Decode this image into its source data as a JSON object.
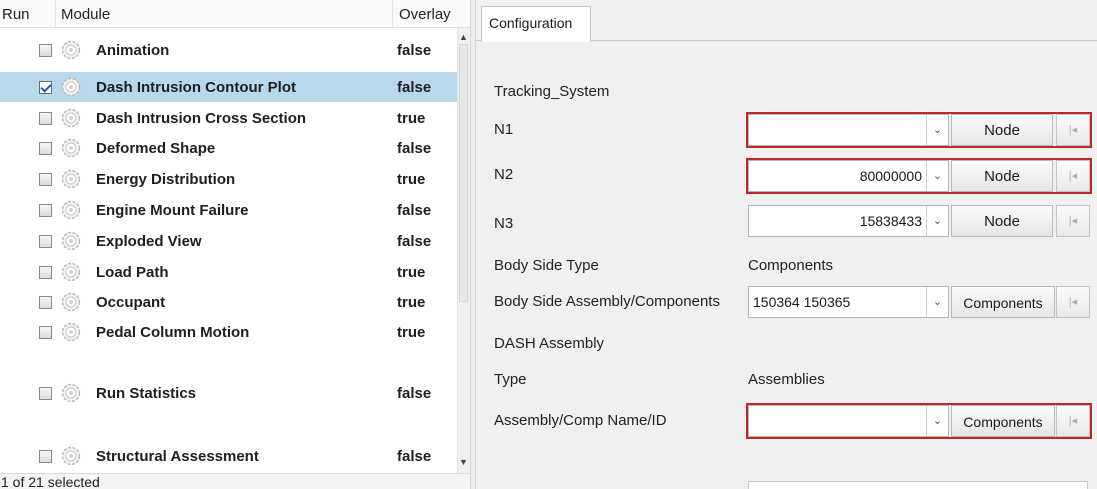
{
  "left_panel": {
    "columns": {
      "run": "Run",
      "module": "Module",
      "overlay": "Overlay"
    },
    "rows": [
      {
        "name": "Animation",
        "overlay": "false",
        "checked": false,
        "selected": false
      },
      {
        "name": "Dash Intrusion Contour Plot",
        "overlay": "false",
        "checked": true,
        "selected": true
      },
      {
        "name": "Dash Intrusion Cross Section",
        "overlay": "true",
        "checked": false,
        "selected": false
      },
      {
        "name": "Deformed Shape",
        "overlay": "false",
        "checked": false,
        "selected": false
      },
      {
        "name": "Energy Distribution",
        "overlay": "true",
        "checked": false,
        "selected": false
      },
      {
        "name": "Engine Mount Failure",
        "overlay": "false",
        "checked": false,
        "selected": false
      },
      {
        "name": "Exploded View",
        "overlay": "false",
        "checked": false,
        "selected": false
      },
      {
        "name": "Load Path",
        "overlay": "true",
        "checked": false,
        "selected": false
      },
      {
        "name": "Occupant",
        "overlay": "true",
        "checked": false,
        "selected": false
      },
      {
        "name": "Pedal Column Motion",
        "overlay": "true",
        "checked": false,
        "selected": false
      },
      {
        "name": "Run Statistics",
        "overlay": "false",
        "checked": false,
        "selected": false
      },
      {
        "name": "Structural Assessment",
        "overlay": "false",
        "checked": false,
        "selected": false
      }
    ],
    "status": "1 of 21 selected"
  },
  "right_panel": {
    "tab": "Configuration",
    "section_tracking": "Tracking_System",
    "n1": {
      "label": "N1",
      "value": "",
      "button": "Node"
    },
    "n2": {
      "label": "N2",
      "value": "80000000",
      "button": "Node"
    },
    "n3": {
      "label": "N3",
      "value": "15838433",
      "button": "Node"
    },
    "body_side_type": {
      "label": "Body Side Type",
      "value": "Components"
    },
    "body_side_assembly": {
      "label": "Body Side Assembly/Components",
      "value": "150364 150365",
      "button": "Components"
    },
    "section_dash": "DASH Assembly",
    "type": {
      "label": "Type",
      "value": "Assemblies"
    },
    "assembly_comp": {
      "label": "Assembly/Comp Name/ID",
      "value": "",
      "button": "Components"
    }
  },
  "colors": {
    "selection": "#b9d8eb",
    "error_border": "#c0272d"
  },
  "icons": [
    "gear-icon",
    "checkbox",
    "dropdown-arrow-icon",
    "pick-entity-icon",
    "scroll-up-icon",
    "scroll-down-icon"
  ]
}
